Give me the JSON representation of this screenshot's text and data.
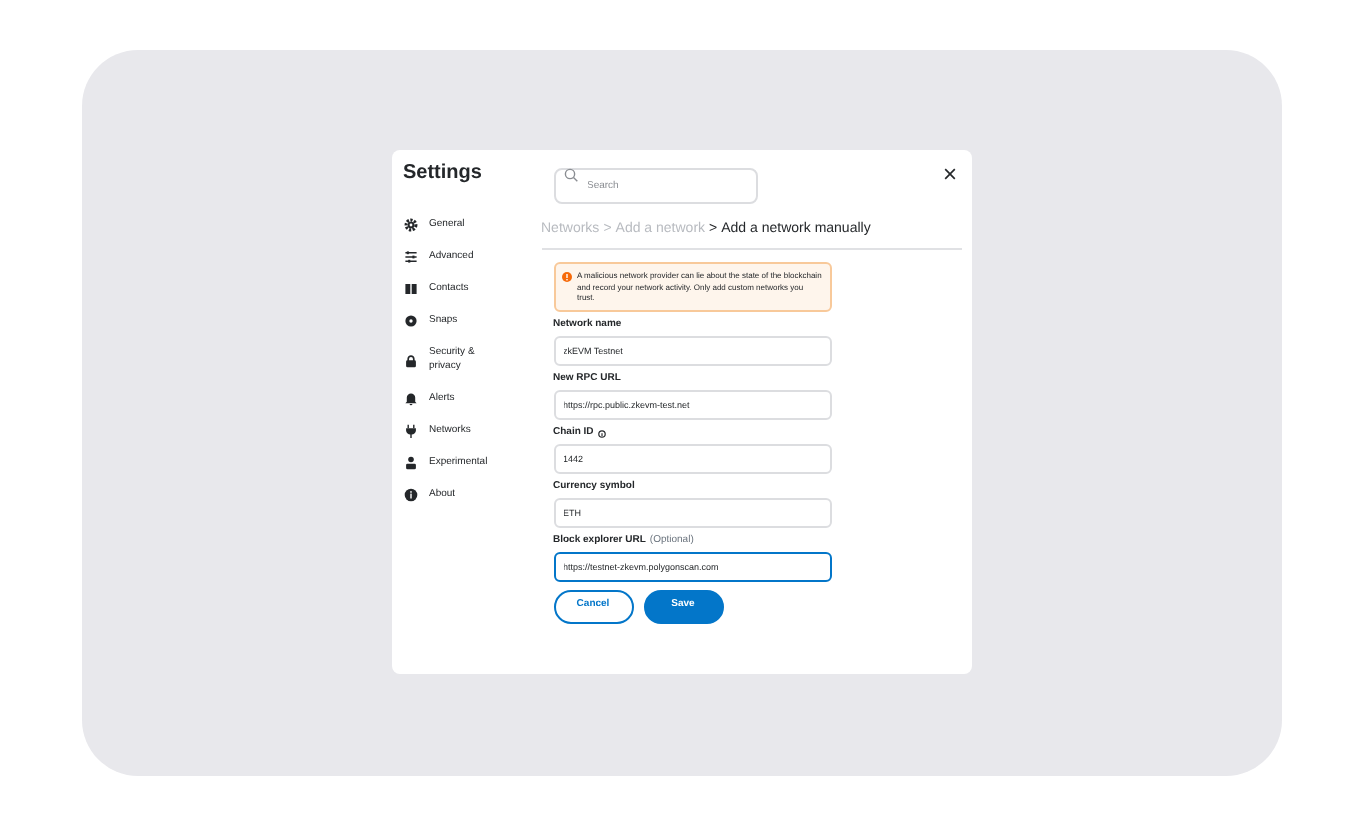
{
  "title": "Settings",
  "search": {
    "placeholder": "Search"
  },
  "sidebar": {
    "items": [
      {
        "label": "General"
      },
      {
        "label": "Advanced"
      },
      {
        "label": "Contacts"
      },
      {
        "label": "Snaps"
      },
      {
        "label": "Security & privacy"
      },
      {
        "label": "Alerts"
      },
      {
        "label": "Networks"
      },
      {
        "label": "Experimental"
      },
      {
        "label": "About"
      }
    ]
  },
  "breadcrumb": [
    {
      "label": "Networks",
      "current": false
    },
    {
      "separator": ">",
      "label": "Add a network",
      "current": false
    },
    {
      "separator": ">",
      "label": "Add a network manually",
      "current": true
    }
  ],
  "warning": "A malicious network provider can lie about the state of the blockchain and record your network activity. Only add custom networks you trust.",
  "fields": [
    {
      "label": "Network name",
      "value": "zkEVM Testnet",
      "focused": false
    },
    {
      "label": "New RPC URL",
      "value": "https://rpc.public.zkevm-test.net",
      "focused": false
    },
    {
      "label": "Chain ID",
      "value": "1442",
      "info": true,
      "focused": false
    },
    {
      "label": "Currency symbol",
      "value": "ETH",
      "focused": false
    },
    {
      "label": "Block explorer URL",
      "optional": "(Optional)",
      "value": "https://testnet-zkevm.polygonscan.com",
      "focused": true
    }
  ],
  "buttons": [
    {
      "label": "Cancel",
      "kind": "secondary"
    },
    {
      "label": "Save",
      "kind": "primary"
    }
  ]
}
